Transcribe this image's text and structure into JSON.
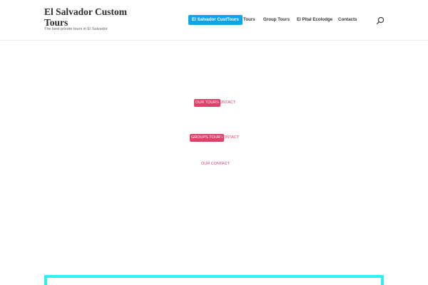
{
  "header": {
    "site_title": "El Salvador Custom Tours",
    "tagline": "The best private tours in El Salvador"
  },
  "nav": {
    "items": [
      {
        "label": "El Salvador CustTours",
        "active": true
      },
      {
        "label": "Tours",
        "active": false
      },
      {
        "label": "Group Tours",
        "active": false
      },
      {
        "label": "El Pital Ecolodge",
        "active": false
      },
      {
        "label": "Contacts",
        "active": false
      }
    ],
    "accent_color": "#0fa4ea"
  },
  "icons": {
    "search": "search-icon"
  },
  "content": {
    "links": [
      {
        "button_label": "OUR TOURS",
        "link_label": "CONTACT"
      },
      {
        "button_label": "GROUPS TOURS",
        "link_label": "CONTACT"
      },
      {
        "link_label": "OUR CONTACT"
      }
    ],
    "button_color": "#e03f6a"
  },
  "footer_box": {
    "border_color": "#2df0f0"
  }
}
